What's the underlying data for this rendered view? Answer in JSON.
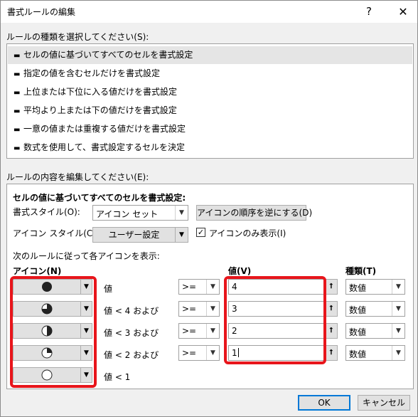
{
  "window": {
    "title": "書式ルールの編集",
    "help": "?",
    "close": "✕"
  },
  "rule_type": {
    "label": "ルールの種類を選択してください(S):",
    "items": [
      "セルの値に基づいてすべてのセルを書式設定",
      "指定の値を含むセルだけを書式設定",
      "上位または下位に入る値だけを書式設定",
      "平均より上または下の値だけを書式設定",
      "一意の値または重複する値だけを書式設定",
      "数式を使用して、書式設定するセルを決定"
    ],
    "selected_index": 0,
    "bullet": "▬"
  },
  "rule_content": {
    "label": "ルールの内容を編集してください(E):",
    "heading": "セルの値に基づいてすべてのセルを書式設定:",
    "format_style_label": "書式スタイル(O):",
    "format_style_value": "アイコン セット",
    "reverse_button": "アイコンの順序を逆にする(D)",
    "icon_style_label": "アイコン スタイル(C):",
    "icon_style_value": "ユーザー設定",
    "show_icon_only_label": "アイコンのみ表示(I)",
    "show_icon_only_checked": true,
    "display_rule_label": "次のルールに従って各アイコンを表示:",
    "col_icon": "アイコン(N)",
    "col_value": "値(V)",
    "col_type": "種類(T)",
    "rows": [
      {
        "icon": "full-circle-icon",
        "desc": "値",
        "op": ">=",
        "value": "4",
        "type": "数値"
      },
      {
        "icon": "three-quarter-circle-icon",
        "desc": "値 < 4 および",
        "op": ">=",
        "value": "3",
        "type": "数値"
      },
      {
        "icon": "half-circle-icon",
        "desc": "値 < 3 および",
        "op": ">=",
        "value": "2",
        "type": "数値"
      },
      {
        "icon": "quarter-circle-icon",
        "desc": "値 < 2 および",
        "op": ">=",
        "value": "1",
        "type": "数値"
      },
      {
        "icon": "empty-circle-icon",
        "desc": "値 < 1"
      }
    ],
    "ref_glyph": "⭡",
    "dropdown_glyph": "▼"
  },
  "footer": {
    "ok": "OK",
    "cancel": "キャンセル"
  },
  "colors": {
    "highlight": "#e8151b",
    "selected_row": "#e5e5e5",
    "default_button": "#0078d7"
  }
}
